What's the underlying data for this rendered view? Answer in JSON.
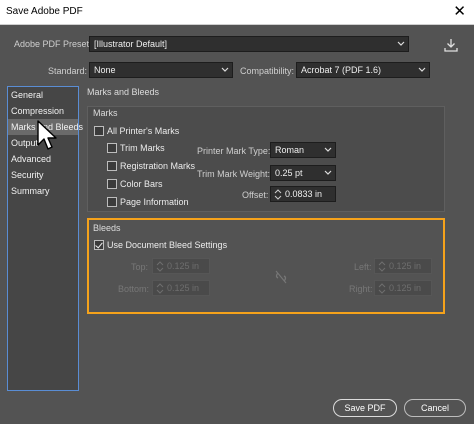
{
  "window": {
    "title": "Save Adobe PDF",
    "close_glyph": "✕"
  },
  "header": {
    "preset_label": "Adobe PDF Preset:",
    "preset_value": "[Illustrator Default]",
    "standard_label": "Standard:",
    "standard_value": "None",
    "compat_label": "Compatibility:",
    "compat_value": "Acrobat 7 (PDF 1.6)",
    "save_preset_icon": "download-icon"
  },
  "sidebar": {
    "items": [
      {
        "label": "General"
      },
      {
        "label": "Compression"
      },
      {
        "label": "Marks and Bleeds",
        "active": true
      },
      {
        "label": "Output"
      },
      {
        "label": "Advanced"
      },
      {
        "label": "Security"
      },
      {
        "label": "Summary"
      }
    ]
  },
  "main": {
    "panel_title": "Marks and Bleeds",
    "marks": {
      "title": "Marks",
      "all_printers_marks": {
        "label": "All Printer's Marks",
        "checked": false
      },
      "trim_marks": {
        "label": "Trim Marks",
        "checked": false
      },
      "registration_marks": {
        "label": "Registration Marks",
        "checked": false
      },
      "color_bars": {
        "label": "Color Bars",
        "checked": false
      },
      "page_information": {
        "label": "Page Information",
        "checked": false
      },
      "printer_mark_type_label": "Printer Mark Type:",
      "printer_mark_type_value": "Roman",
      "trim_mark_weight_label": "Trim Mark Weight:",
      "trim_mark_weight_value": "0.25 pt",
      "offset_label": "Offset:",
      "offset_value": "0.0833 in"
    },
    "bleeds": {
      "title": "Bleeds",
      "use_doc_bleed": {
        "label": "Use Document Bleed Settings",
        "checked": true
      },
      "top_label": "Top:",
      "top_value": "0.125 in",
      "bottom_label": "Bottom:",
      "bottom_value": "0.125 in",
      "left_label": "Left:",
      "left_value": "0.125 in",
      "right_label": "Right:",
      "right_value": "0.125 in",
      "link_icon": "unlink-icon"
    }
  },
  "footer": {
    "save_label": "Save PDF",
    "cancel_label": "Cancel"
  },
  "colors": {
    "dialog_bg": "#535353",
    "highlight": "#f5a21b",
    "sidebar_border": "#5a8dd4"
  }
}
